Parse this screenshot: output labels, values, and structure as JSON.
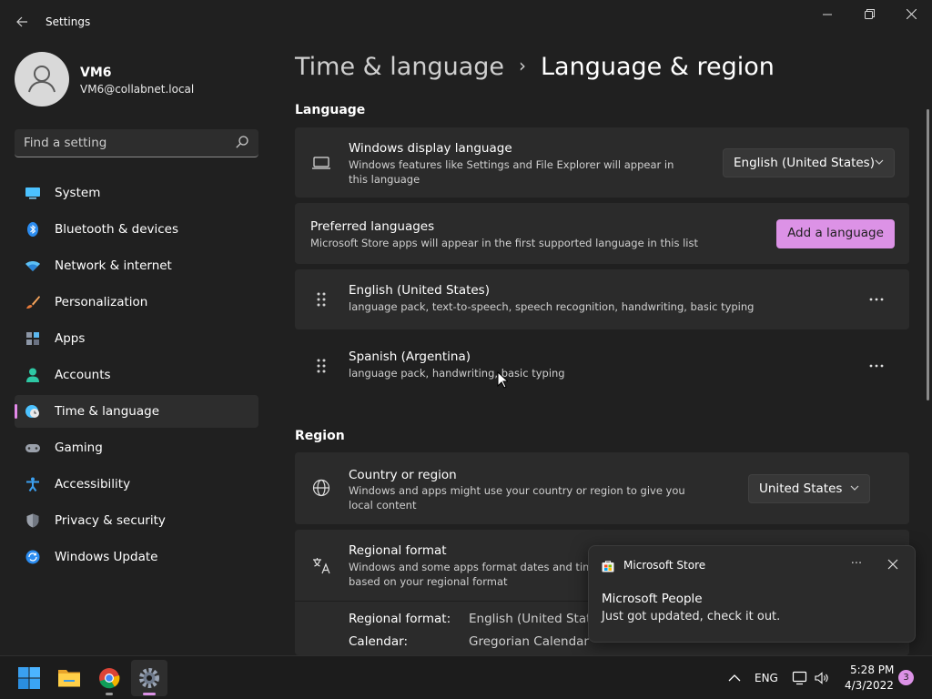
{
  "window": {
    "title": "Settings",
    "controls": [
      "minimize",
      "maximize",
      "close"
    ]
  },
  "user": {
    "name": "VM6",
    "email": "VM6@collabnet.local"
  },
  "search": {
    "placeholder": "Find a setting"
  },
  "sidebar": {
    "items": [
      {
        "label": "System",
        "icon": "monitor-icon"
      },
      {
        "label": "Bluetooth & devices",
        "icon": "bluetooth-icon"
      },
      {
        "label": "Network & internet",
        "icon": "wifi-icon"
      },
      {
        "label": "Personalization",
        "icon": "brush-icon"
      },
      {
        "label": "Apps",
        "icon": "apps-icon"
      },
      {
        "label": "Accounts",
        "icon": "person-icon"
      },
      {
        "label": "Time & language",
        "icon": "clock-globe-icon",
        "active": true
      },
      {
        "label": "Gaming",
        "icon": "gamepad-icon"
      },
      {
        "label": "Accessibility",
        "icon": "accessibility-icon"
      },
      {
        "label": "Privacy & security",
        "icon": "shield-icon"
      },
      {
        "label": "Windows Update",
        "icon": "update-icon"
      }
    ]
  },
  "breadcrumb": {
    "parent": "Time & language",
    "separator": "›",
    "current": "Language & region"
  },
  "language_section": {
    "title": "Language",
    "display_language": {
      "title": "Windows display language",
      "description": "Windows features like Settings and File Explorer will appear in this language",
      "value": "English (United States)"
    },
    "preferred": {
      "title": "Preferred languages",
      "description": "Microsoft Store apps will appear in the first supported language in this list",
      "button": "Add a language"
    },
    "languages": [
      {
        "name": "English (United States)",
        "features": "language pack, text-to-speech, speech recognition, handwriting, basic typing"
      },
      {
        "name": "Spanish (Argentina)",
        "features": "language pack, handwriting, basic typing"
      }
    ]
  },
  "region_section": {
    "title": "Region",
    "country": {
      "title": "Country or region",
      "description": "Windows and apps might use your country or region to give you local content",
      "value": "United States"
    },
    "format": {
      "title": "Regional format",
      "description": "Windows and some apps format dates and times based on your regional format",
      "rows": [
        {
          "label": "Regional format:",
          "value": "English (United States)"
        },
        {
          "label": "Calendar:",
          "value": "Gregorian Calendar"
        }
      ]
    }
  },
  "toast": {
    "app": "Microsoft Store",
    "more": "···",
    "title": "Microsoft People",
    "body": "Just got updated, check it out."
  },
  "taskbar": {
    "apps": [
      "windows-start",
      "file-explorer",
      "chrome",
      "settings"
    ],
    "language": "ENG",
    "time": "5:28 PM",
    "date": "4/3/2022",
    "notifications": "3"
  },
  "colors": {
    "accent": "#dc92e6",
    "background": "#202020",
    "card": "#2b2b2b"
  }
}
